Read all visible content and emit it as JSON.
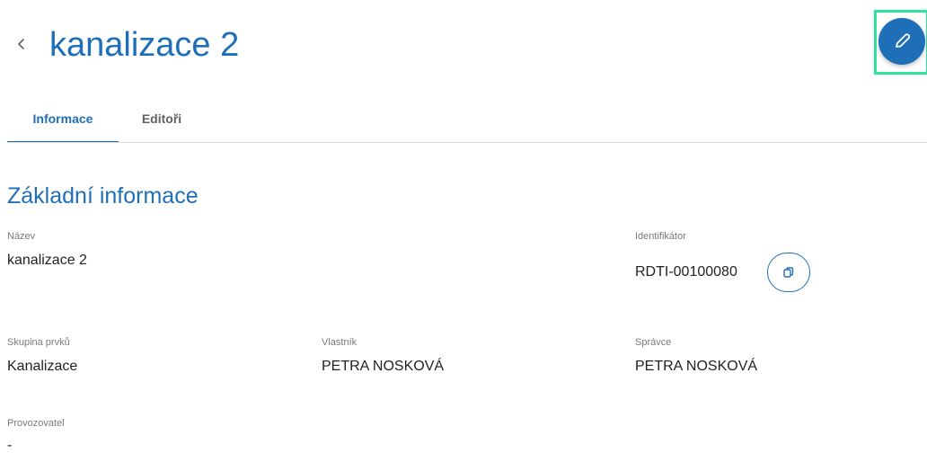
{
  "header": {
    "back_icon": "chevron-left-icon",
    "title": "kanalizace 2",
    "edit_icon": "pencil-icon"
  },
  "tabs": [
    {
      "label": "Informace",
      "active": true
    },
    {
      "label": "Editoři",
      "active": false
    }
  ],
  "section": {
    "title": "Základní informace"
  },
  "fields": {
    "nazev": {
      "label": "Název",
      "value": "kanalizace 2"
    },
    "identifikator": {
      "label": "Identifikátor",
      "value": "RDTI-00100080",
      "copy_icon": "copy-icon"
    },
    "skupina": {
      "label": "Skupina prvků",
      "value": "Kanalizace"
    },
    "vlastnik": {
      "label": "Vlastník",
      "value": "PETRA NOSKOVÁ"
    },
    "spravce": {
      "label": "Správce",
      "value": "PETRA NOSKOVÁ"
    },
    "provozovatel": {
      "label": "Provozovatel",
      "value": "-"
    }
  },
  "colors": {
    "accent": "#1f6fb8",
    "highlight": "#2ee59d"
  }
}
